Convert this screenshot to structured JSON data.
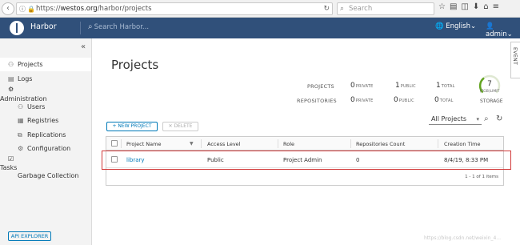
{
  "browser": {
    "url_scheme": "https://",
    "url_host": "westos.org",
    "url_path": "/harbor/projects",
    "search_placeholder": "Search"
  },
  "header": {
    "brand": "Harbor",
    "search_placeholder": "Search Harbor...",
    "language": "English",
    "user": "admin",
    "bg_color": "#30507a"
  },
  "sidebar": {
    "items": [
      {
        "label": "Projects",
        "icon": "projects-icon"
      },
      {
        "label": "Logs",
        "icon": "logs-icon"
      }
    ],
    "administration_label": "Administration",
    "admin_items": [
      {
        "label": "Users",
        "icon": "users-icon"
      },
      {
        "label": "Registries",
        "icon": "registries-icon"
      },
      {
        "label": "Replications",
        "icon": "replications-icon"
      },
      {
        "label": "Configuration",
        "icon": "configuration-icon"
      }
    ],
    "tasks_label": "Tasks",
    "task_items": [
      {
        "label": "Garbage Collection"
      }
    ],
    "api_explorer": "API EXPLORER"
  },
  "main": {
    "title": "Projects",
    "summary": {
      "projects_label": "PROJECTS",
      "repositories_label": "REPOSITORIES",
      "private_unit": "PRIVATE",
      "public_unit": "PUBLIC",
      "total_unit": "TOTAL",
      "projects_private": "0",
      "projects_public": "1",
      "projects_total": "1",
      "repos_private": "0",
      "repos_public": "0",
      "repos_total": "0",
      "storage_value": "7",
      "storage_limit": "(7GB)LIMIT",
      "storage_label": "STORAGE",
      "storage_accent": "#62a420"
    },
    "event_tab": "EVENT",
    "new_project": "+ NEW PROJECT",
    "delete": "✕ DELETE",
    "filter_selected": "All Projects",
    "table": {
      "columns": [
        "Project Name",
        "Access Level",
        "Role",
        "Repositories Count",
        "Creation Time"
      ],
      "rows": [
        {
          "name": "library",
          "access": "Public",
          "role": "Project Admin",
          "repos": "0",
          "created": "8/4/19, 8:33 PM"
        }
      ],
      "pager": "1 - 1 of 1 items"
    }
  },
  "watermark": "https://blog.csdn.net/weixin_4..."
}
